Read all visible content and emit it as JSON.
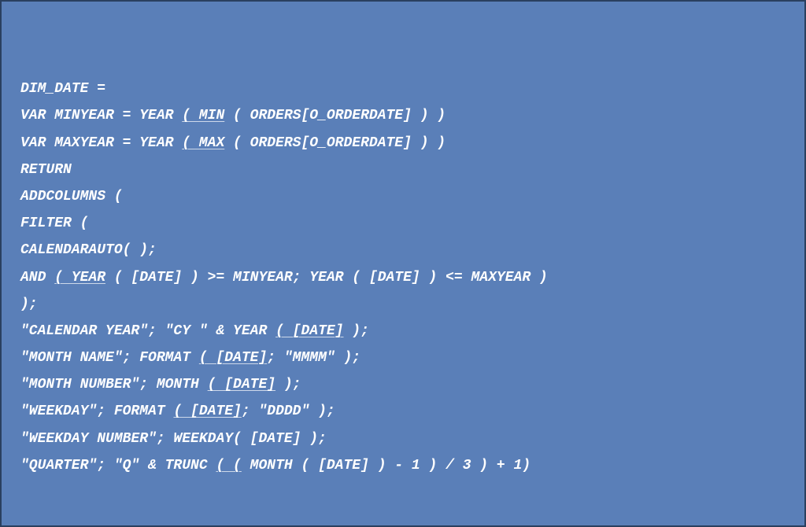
{
  "code": {
    "line1": "DIM_DATE =",
    "line2_a": "VAR MINYEAR = YEAR ",
    "line2_b": "( MIN",
    "line2_c": " ( ORDERS[O_ORDERDATE] ) )",
    "line3_a": "VAR MAXYEAR = YEAR ",
    "line3_b": "( MAX",
    "line3_c": " ( ORDERS[O_ORDERDATE] ) )",
    "line4": "RETURN",
    "line5": "ADDCOLUMNS (",
    "line6": "FILTER (",
    "line7": "CALENDARAUTO( );",
    "line8_a": "AND ",
    "line8_b": "( YEAR",
    "line8_c": " ( [DATE] ) >= MINYEAR; YEAR ( [DATE] ) <= MAXYEAR )",
    "line9": ");",
    "line10_a": "\"CALENDAR YEAR\"; \"CY \" & YEAR ",
    "line10_b": "( [DATE]",
    "line10_c": " );",
    "line11_a": "\"MONTH NAME\"; FORMAT ",
    "line11_b": "( [DATE]",
    "line11_c": "; \"MMMM\" );",
    "line12_a": "\"MONTH NUMBER\"; MONTH ",
    "line12_b": "( [DATE]",
    "line12_c": " );",
    "line13_a": "\"WEEKDAY\"; FORMAT ",
    "line13_b": "( [DATE]",
    "line13_c": "; \"DDDD\" );",
    "line14": "\"WEEKDAY NUMBER\"; WEEKDAY( [DATE] );",
    "line15_a": "\"QUARTER\"; \"Q\" & TRUNC ",
    "line15_b": "( (",
    "line15_c": " MONTH ( [DATE] ) - 1 ) / 3 ) + 1)"
  }
}
